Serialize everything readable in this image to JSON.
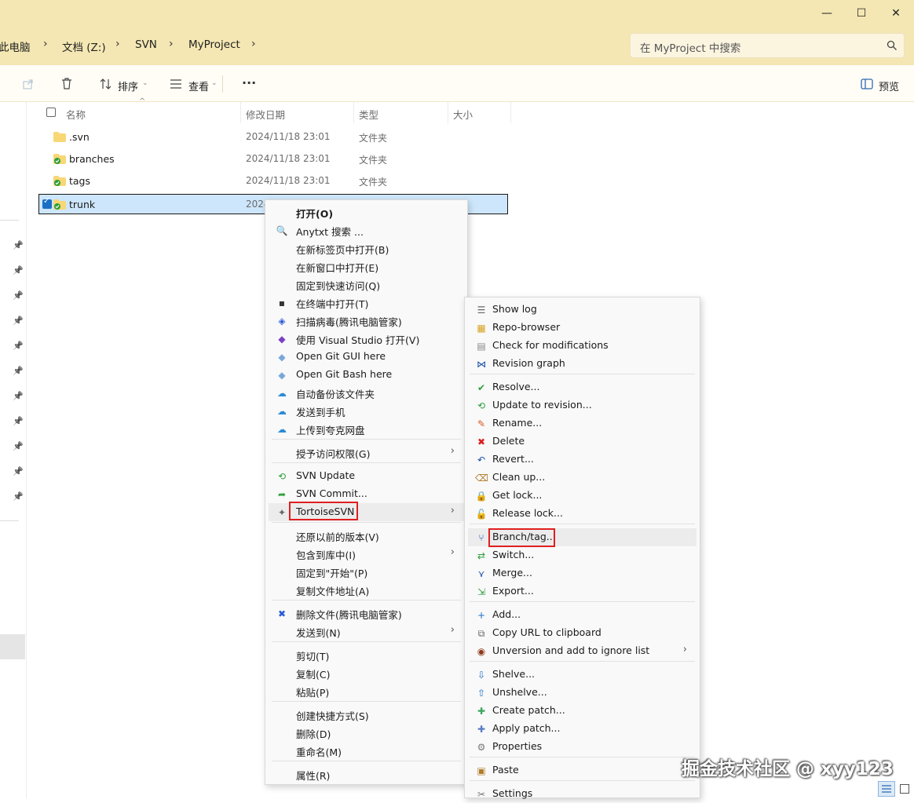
{
  "window": {
    "minimize": "—",
    "maximize": "☐",
    "close": "✕"
  },
  "breadcrumb": {
    "items": [
      "此电脑",
      "文档 (Z:)",
      "SVN",
      "MyProject"
    ],
    "separator": "›"
  },
  "search": {
    "placeholder": "在 MyProject 中搜索"
  },
  "toolbar": {
    "sort_label": "排序",
    "view_label": "查看",
    "more_label": "···",
    "preview_label": "预览"
  },
  "columns": {
    "name": "名称",
    "modified": "修改日期",
    "type": "类型",
    "size": "大小"
  },
  "files": [
    {
      "name": ".svn",
      "date": "2024/11/18 23:01",
      "type": "文件夹"
    },
    {
      "name": "branches",
      "date": "2024/11/18 23:01",
      "type": "文件夹"
    },
    {
      "name": "tags",
      "date": "2024/11/18 23:01",
      "type": "文件夹"
    },
    {
      "name": "trunk",
      "date": "2024",
      "type": ""
    }
  ],
  "context_menu": {
    "items": [
      "打开(O)",
      "Anytxt 搜索 ...",
      "在新标签页中打开(B)",
      "在新窗口中打开(E)",
      "固定到快速访问(Q)",
      "在终端中打开(T)",
      "扫描病毒(腾讯电脑管家)",
      "使用 Visual Studio 打开(V)",
      "Open Git GUI here",
      "Open Git Bash here",
      "自动备份该文件夹",
      "发送到手机",
      "上传到夸克网盘",
      "授予访问权限(G)",
      "SVN Update",
      "SVN Commit...",
      "TortoiseSVN",
      "还原以前的版本(V)",
      "包含到库中(I)",
      "固定到\"开始\"(P)",
      "复制文件地址(A)",
      "删除文件(腾讯电脑管家)",
      "发送到(N)",
      "剪切(T)",
      "复制(C)",
      "粘贴(P)",
      "创建快捷方式(S)",
      "删除(D)",
      "重命名(M)",
      "属性(R)"
    ]
  },
  "svn_submenu": {
    "items": [
      "Show log",
      "Repo-browser",
      "Check for modifications",
      "Revision graph",
      "Resolve...",
      "Update to revision...",
      "Rename...",
      "Delete",
      "Revert...",
      "Clean up...",
      "Get lock...",
      "Release lock...",
      "Branch/tag...",
      "Switch...",
      "Merge...",
      "Export...",
      "Add...",
      "Copy URL to clipboard",
      "Unversion and add to ignore list",
      "Shelve...",
      "Unshelve...",
      "Create patch...",
      "Apply patch...",
      "Properties",
      "Paste",
      "Settings"
    ]
  },
  "watermark": "掘金技术社区 @ xyy123",
  "colors": {
    "titlebar": "#f4e7b3",
    "selection": "#cde6fb",
    "highlight_box": "#e02020"
  }
}
